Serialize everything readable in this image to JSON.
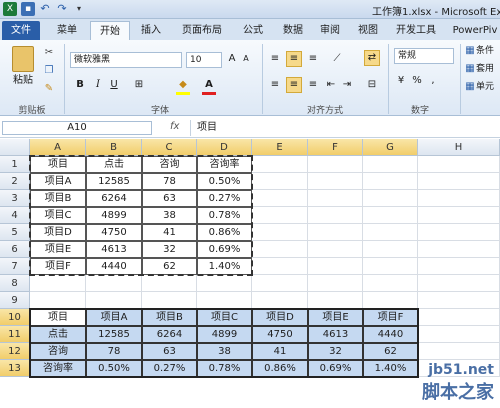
{
  "window": {
    "title": "工作簿1.xlsx - Microsoft Ex"
  },
  "tabs": [
    "文件",
    "菜单",
    "开始",
    "插入",
    "页面布局",
    "公式",
    "数据",
    "审阅",
    "视图",
    "开发工具",
    "PowerPiv"
  ],
  "ribbon": {
    "paste_label": "粘贴",
    "font_name": "微软雅黑",
    "font_size": "10",
    "number_format": "常规",
    "cond_format": "条件",
    "table_format": "套用",
    "cell_style": "单元",
    "groups": [
      "剪贴板",
      "字体",
      "对齐方式",
      "数字"
    ]
  },
  "formula_bar": {
    "name_box": "A10",
    "fx": "fx",
    "value": "项目"
  },
  "columns": [
    "A",
    "B",
    "C",
    "D",
    "E",
    "F",
    "G",
    "H"
  ],
  "rows": [
    "1",
    "2",
    "3",
    "4",
    "5",
    "6",
    "7",
    "8",
    "9",
    "10",
    "11",
    "12",
    "13"
  ],
  "table1": [
    [
      "项目",
      "点击",
      "咨询",
      "咨询率"
    ],
    [
      "项目A",
      "12585",
      "78",
      "0.50%"
    ],
    [
      "项目B",
      "6264",
      "63",
      "0.27%"
    ],
    [
      "项目C",
      "4899",
      "38",
      "0.78%"
    ],
    [
      "项目D",
      "4750",
      "41",
      "0.86%"
    ],
    [
      "项目E",
      "4613",
      "32",
      "0.69%"
    ],
    [
      "项目F",
      "4440",
      "62",
      "1.40%"
    ]
  ],
  "table2": [
    [
      "项目",
      "项目A",
      "项目B",
      "项目C",
      "项目D",
      "项目E",
      "项目F"
    ],
    [
      "点击",
      "12585",
      "6264",
      "4899",
      "4750",
      "4613",
      "4440"
    ],
    [
      "咨询",
      "78",
      "63",
      "38",
      "41",
      "32",
      "62"
    ],
    [
      "咨询率",
      "0.50%",
      "0.27%",
      "0.78%",
      "0.86%",
      "0.69%",
      "1.40%"
    ]
  ],
  "watermark": {
    "line1": "jb51.net",
    "line2": "脚本之家"
  },
  "colors": {
    "tab_file": "#2a5ea8",
    "selection": "#c5d9f1",
    "header_bg": "#dde6f0"
  }
}
